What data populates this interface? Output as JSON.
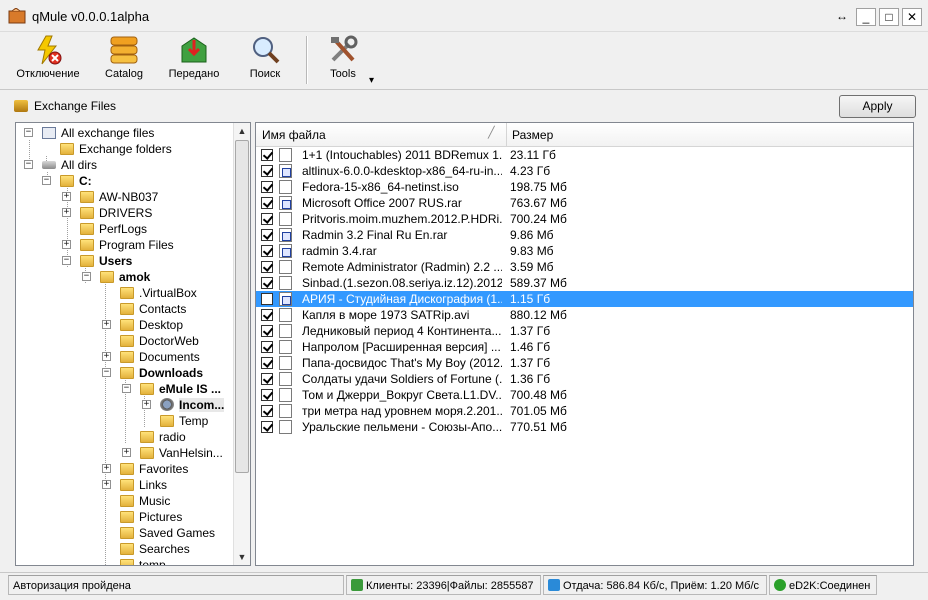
{
  "window": {
    "title": "qMule v0.0.0.1alpha"
  },
  "title_buttons": {
    "resize": "↔",
    "minimize": "_",
    "maximize": "□",
    "close": "✕"
  },
  "toolbar": {
    "items": [
      {
        "label": "Отключение",
        "icon": "disconnect-icon"
      },
      {
        "label": "Catalog",
        "icon": "catalog-icon"
      },
      {
        "label": "Передано",
        "icon": "transfers-icon"
      },
      {
        "label": "Поиск",
        "icon": "search-icon"
      },
      {
        "label": "Tools",
        "icon": "tools-icon"
      }
    ],
    "tools_dropdown": "▾"
  },
  "panel": {
    "label": "Exchange Files",
    "apply_label": "Apply"
  },
  "tree": {
    "expander_plus": "+",
    "expander_minus": "−",
    "nodes": [
      {
        "label": "All exchange files",
        "icon": "pc",
        "level": 0,
        "exp": "minus"
      },
      {
        "label": "Exchange folders",
        "icon": "folder",
        "level": 1,
        "exp": ""
      },
      {
        "label": "All dirs",
        "icon": "drive",
        "level": 0,
        "exp": "minus"
      },
      {
        "label": "C:",
        "icon": "folder",
        "level": 1,
        "exp": "minus",
        "bold": true
      },
      {
        "label": "AW-NB037",
        "icon": "folder",
        "level": 2,
        "exp": "plus"
      },
      {
        "label": "DRIVERS",
        "icon": "folder",
        "level": 2,
        "exp": "plus"
      },
      {
        "label": "PerfLogs",
        "icon": "folder",
        "level": 2,
        "exp": ""
      },
      {
        "label": "Program Files",
        "icon": "folder",
        "level": 2,
        "exp": "plus"
      },
      {
        "label": "Users",
        "icon": "folder",
        "level": 2,
        "exp": "minus",
        "bold": true
      },
      {
        "label": "amok",
        "icon": "folder",
        "level": 3,
        "exp": "minus",
        "bold": true
      },
      {
        "label": ".VirtualBox",
        "icon": "folder",
        "level": 4,
        "exp": ""
      },
      {
        "label": "Contacts",
        "icon": "folder",
        "level": 4,
        "exp": ""
      },
      {
        "label": "Desktop",
        "icon": "folder",
        "level": 4,
        "exp": "plus"
      },
      {
        "label": "DoctorWeb",
        "icon": "folder",
        "level": 4,
        "exp": ""
      },
      {
        "label": "Documents",
        "icon": "folder",
        "level": 4,
        "exp": "plus"
      },
      {
        "label": "Downloads",
        "icon": "folder",
        "level": 4,
        "exp": "minus",
        "bold": true
      },
      {
        "label": "eMule IS ...",
        "icon": "folder",
        "level": 5,
        "exp": "minus",
        "bold": true
      },
      {
        "label": "Incom...",
        "icon": "gear",
        "level": 6,
        "exp": "plus",
        "bold": true,
        "selected": true
      },
      {
        "label": "Temp",
        "icon": "folder",
        "level": 6,
        "exp": ""
      },
      {
        "label": "radio",
        "icon": "folder",
        "level": 5,
        "exp": ""
      },
      {
        "label": "VanHelsin...",
        "icon": "folder",
        "level": 5,
        "exp": "plus"
      },
      {
        "label": "Favorites",
        "icon": "folder",
        "level": 4,
        "exp": "plus"
      },
      {
        "label": "Links",
        "icon": "folder",
        "level": 4,
        "exp": "plus"
      },
      {
        "label": "Music",
        "icon": "folder",
        "level": 4,
        "exp": ""
      },
      {
        "label": "Pictures",
        "icon": "folder",
        "level": 4,
        "exp": ""
      },
      {
        "label": "Saved Games",
        "icon": "folder",
        "level": 4,
        "exp": ""
      },
      {
        "label": "Searches",
        "icon": "folder",
        "level": 4,
        "exp": ""
      },
      {
        "label": "temp",
        "icon": "folder",
        "level": 4,
        "exp": ""
      }
    ]
  },
  "file_list": {
    "columns": {
      "name": "Имя файла",
      "size": "Размер"
    },
    "rows": [
      {
        "name": "1+1 (Intouchables) 2011 BDRemux 1...",
        "size": "23.11 Гб",
        "checked": true,
        "badge": false
      },
      {
        "name": "altlinux-6.0.0-kdesktop-x86_64-ru-in...",
        "size": "4.23 Гб",
        "checked": true,
        "badge": true
      },
      {
        "name": "Fedora-15-x86_64-netinst.iso",
        "size": "198.75 Мб",
        "checked": true,
        "badge": false
      },
      {
        "name": "Microsoft Office 2007 RUS.rar",
        "size": "763.67 Мб",
        "checked": true,
        "badge": true
      },
      {
        "name": "Pritvoris.moim.muzhem.2012.P.HDRi...",
        "size": "700.24 Мб",
        "checked": true,
        "badge": false
      },
      {
        "name": "Radmin 3.2 Final Ru En.rar",
        "size": "9.86 Мб",
        "checked": true,
        "badge": true
      },
      {
        "name": "radmin 3.4.rar",
        "size": "9.83 Мб",
        "checked": true,
        "badge": true
      },
      {
        "name": "Remote Administrator (Radmin) 2.2 ...",
        "size": "3.59 Мб",
        "checked": true,
        "badge": false
      },
      {
        "name": "Sinbad.(1.sezon.08.seriya.iz.12).2012...",
        "size": "589.37 Мб",
        "checked": true,
        "badge": false
      },
      {
        "name": "АРИЯ - Студийная Дискография (1...",
        "size": "1.15 Гб",
        "checked": false,
        "badge": true,
        "selected": true
      },
      {
        "name": "Капля в море 1973 SATRip.avi",
        "size": "880.12 Мб",
        "checked": true,
        "badge": false
      },
      {
        "name": "Ледниковый период 4 Континента...",
        "size": "1.37 Гб",
        "checked": true,
        "badge": false
      },
      {
        "name": "Напролом [Расширенная версия] ...",
        "size": "1.46 Гб",
        "checked": true,
        "badge": false
      },
      {
        "name": "Папа-досвидос That's My Boy (2012...",
        "size": "1.37 Гб",
        "checked": true,
        "badge": false
      },
      {
        "name": "Солдаты удачи Soldiers of Fortune (...",
        "size": "1.36 Гб",
        "checked": true,
        "badge": false
      },
      {
        "name": "Том и Джерри_Вокруг Света.L1.DV...",
        "size": "700.48 Мб",
        "checked": true,
        "badge": false
      },
      {
        "name": "три метра над уровнем моря.2.201...",
        "size": "701.05 Мб",
        "checked": true,
        "badge": false
      },
      {
        "name": "Уральские пельмени - Союзы-Апо...",
        "size": "770.51 Мб",
        "checked": true,
        "badge": false
      }
    ]
  },
  "status": {
    "auth": "Авторизация пройдена",
    "clients": "Клиенты: 23396|Файлы: 2855587",
    "transfer": "Отдача: 586.84 Кб/c, Приём: 1.20 Мб/c",
    "network": "eD2K:Соединен"
  }
}
